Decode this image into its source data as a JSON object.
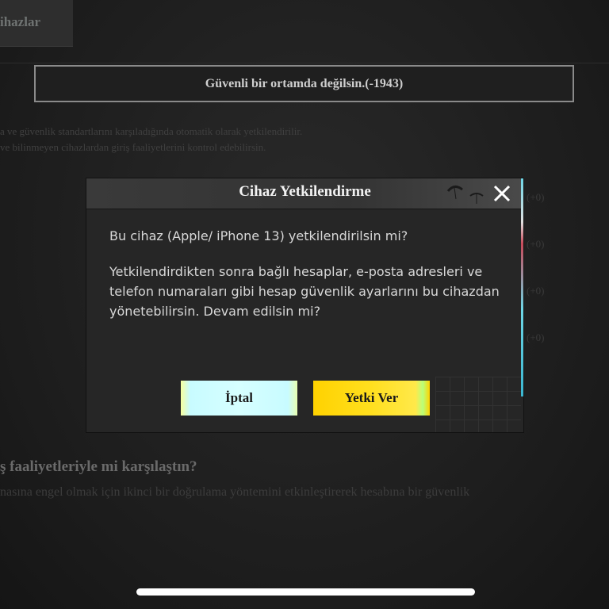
{
  "background": {
    "tab_label": "ihazlar",
    "warning_banner": "Güvenli bir ortamda değilsin.(-1943)",
    "description_lines": [
      "a ve güvenlik standartlarını karşıladığında otomatik olarak yetkilendirilir.",
      "ve bilinmeyen cihazlardan giriş faaliyetlerini kontrol edebilirsin."
    ],
    "counters": [
      "(+0)",
      "(+0)",
      "(+0)",
      "(+0)"
    ],
    "faq_title": "ş faaliyetleriyle mi karşılaştın?",
    "faq_text": "nasına engel olmak için ikinci bir doğrulama yöntemini etkinleştirerek hesabına bir güvenlik"
  },
  "dialog": {
    "title": "Cihaz Yetkilendirme",
    "question": "Bu cihaz (Apple/ iPhone 13) yetkilendirilsin mi?",
    "paragraph": "Yetkilendirdikten sonra bağlı hesaplar, e-posta adresleri ve telefon numaraları gibi hesap güvenlik ayarlarını bu cihazdan yönetebilirsin. Devam edilsin mi?",
    "cancel_label": "İptal",
    "confirm_label": "Yetki Ver",
    "close_icon": "close-icon"
  },
  "colors": {
    "confirm_button": "#ffd200",
    "cancel_button": "#d6ffff",
    "dialog_bg": "#262626"
  }
}
